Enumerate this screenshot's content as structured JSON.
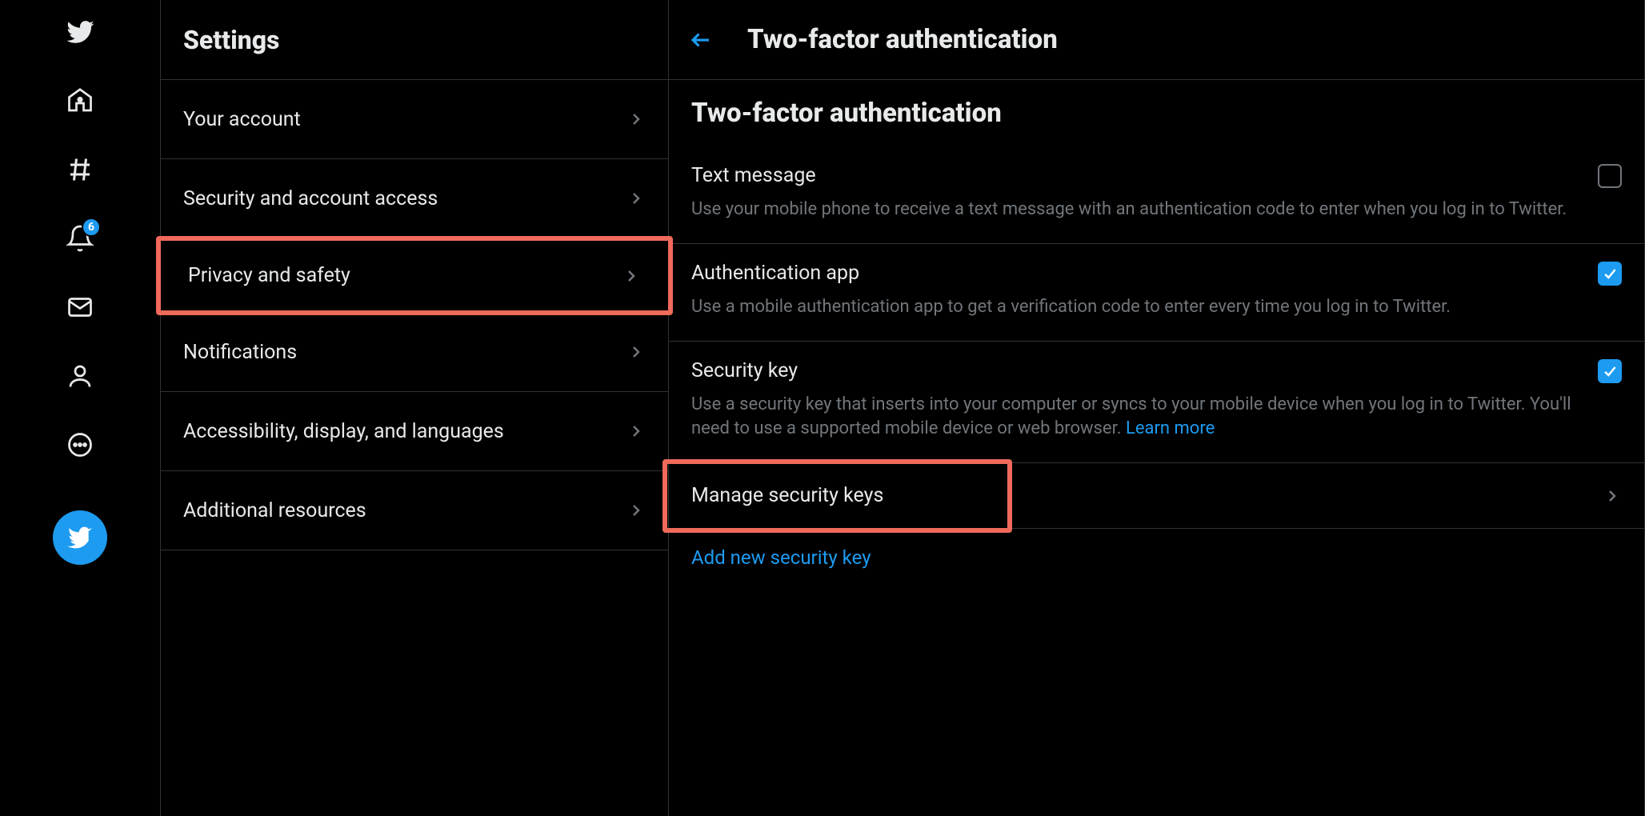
{
  "sidebar": {
    "notification_count": "6"
  },
  "settings": {
    "title": "Settings",
    "items": [
      "Your account",
      "Security and account access",
      "Privacy and safety",
      "Notifications",
      "Accessibility, display, and languages",
      "Additional resources"
    ]
  },
  "main": {
    "header_title": "Two-factor authentication",
    "section_title": "Two-factor authentication",
    "options": [
      {
        "label": "Text message",
        "desc": "Use your mobile phone to receive a text message with an authentication code to enter when you log in to Twitter.",
        "checked": false
      },
      {
        "label": "Authentication app",
        "desc": "Use a mobile authentication app to get a verification code to enter every time you log in to Twitter.",
        "checked": true
      },
      {
        "label": "Security key",
        "desc": "Use a security key that inserts into your computer or syncs to your mobile device when you log in to Twitter. You'll need to use a supported mobile device or web browser. ",
        "link": "Learn more",
        "checked": true
      }
    ],
    "manage_label": "Manage security keys",
    "add_label": "Add new security key"
  }
}
